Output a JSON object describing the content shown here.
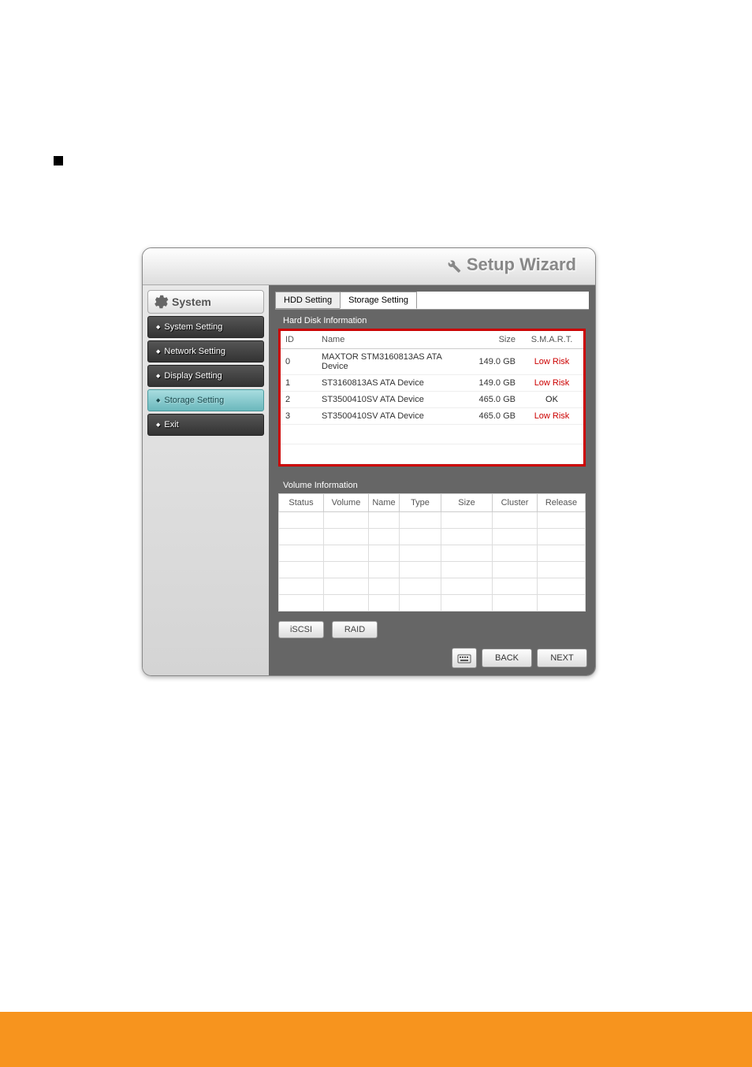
{
  "header": {
    "title": "Setup Wizard"
  },
  "sidebar": {
    "header": "System",
    "items": [
      {
        "label": "System Setting"
      },
      {
        "label": "Network Setting"
      },
      {
        "label": "Display Setting"
      },
      {
        "label": "Storage Setting",
        "active": true
      },
      {
        "label": "Exit"
      }
    ]
  },
  "tabs": {
    "hdd": "HDD Setting",
    "storage": "Storage Setting"
  },
  "hdd": {
    "title": "Hard Disk Information",
    "cols": {
      "id": "ID",
      "name": "Name",
      "size": "Size",
      "smart": "S.M.A.R.T."
    },
    "rows": [
      {
        "id": "0",
        "name": "MAXTOR STM3160813AS ATA Device",
        "size": "149.0 GB",
        "smart": "Low Risk",
        "risk": true
      },
      {
        "id": "1",
        "name": "ST3160813AS ATA Device",
        "size": "149.0 GB",
        "smart": "Low Risk",
        "risk": true
      },
      {
        "id": "2",
        "name": "ST3500410SV ATA Device",
        "size": "465.0 GB",
        "smart": "OK",
        "risk": false
      },
      {
        "id": "3",
        "name": "ST3500410SV ATA Device",
        "size": "465.0 GB",
        "smart": "Low Risk",
        "risk": true
      }
    ]
  },
  "volume": {
    "title": "Volume Information",
    "cols": {
      "status": "Status",
      "volume": "Volume",
      "name": "Name",
      "type": "Type",
      "size": "Size",
      "cluster": "Cluster",
      "release": "Release"
    }
  },
  "buttons": {
    "iscsi": "iSCSI",
    "raid": "RAID",
    "back": "BACK",
    "next": "NEXT"
  }
}
